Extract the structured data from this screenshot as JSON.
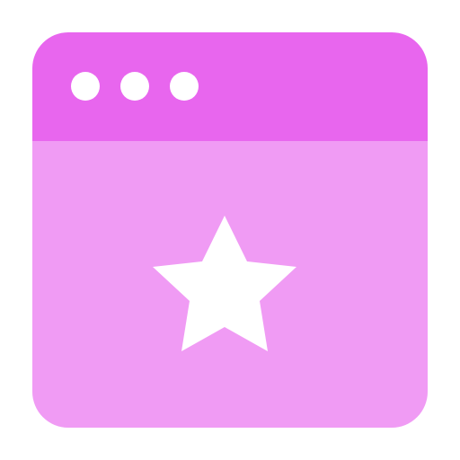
{
  "icon": {
    "name": "browser-window-star-icon",
    "titlebar_color": "#e866ee",
    "body_color": "#f09bf4",
    "symbol_color": "#ffffff",
    "window_dots": 3,
    "center_symbol": "star-icon"
  }
}
